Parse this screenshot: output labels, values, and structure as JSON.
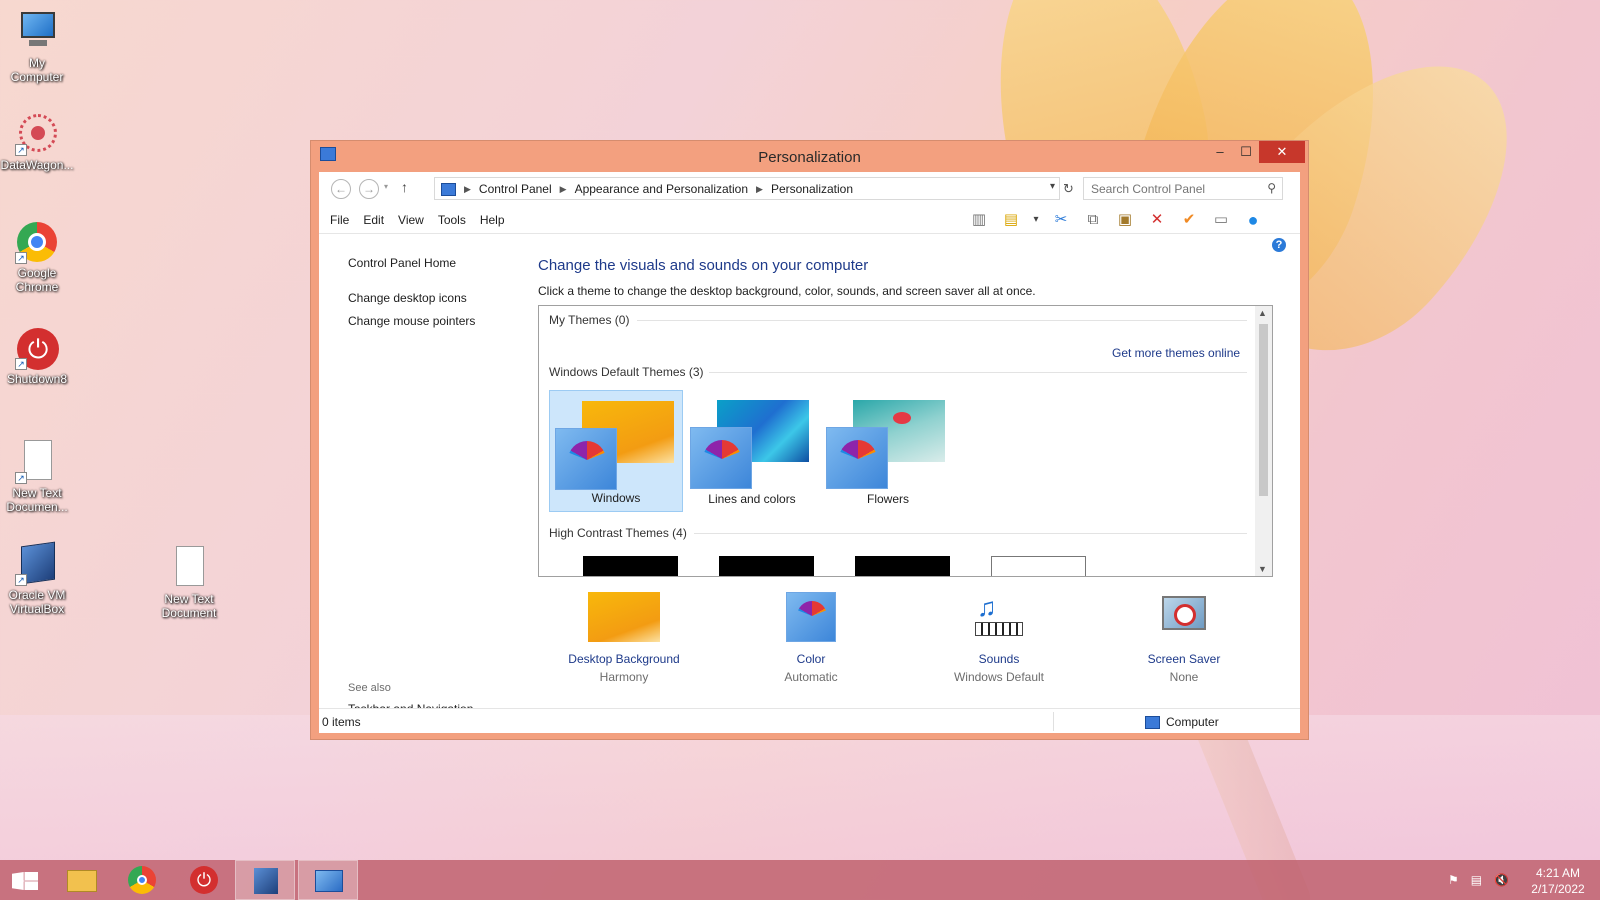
{
  "desktop": {
    "icons": [
      {
        "label": "My\nComputer"
      },
      {
        "label": "DataWagon..."
      },
      {
        "label": "Google\nChrome"
      },
      {
        "label": "Shutdown8"
      },
      {
        "label": "New Text\nDocumen..."
      },
      {
        "label": "Oracle VM\nVirtualBox"
      },
      {
        "label": "New Text\nDocument"
      }
    ]
  },
  "window": {
    "title": "Personalization",
    "controls": {
      "minimize": "–",
      "maximize": "☐",
      "close": "✕"
    },
    "address": {
      "crumbs": [
        "Control Panel",
        "Appearance and Personalization",
        "Personalization"
      ]
    },
    "search": {
      "placeholder": "Search Control Panel"
    },
    "menu": [
      "File",
      "Edit",
      "View",
      "Tools",
      "Help"
    ],
    "left_nav": {
      "home": "Control Panel Home",
      "links": [
        "Change desktop icons",
        "Change mouse pointers"
      ],
      "see_also_label": "See also",
      "see_also_links": [
        "Taskbar and Navigation"
      ]
    },
    "main": {
      "heading": "Change the visuals and sounds on your computer",
      "description": "Click a theme to change the desktop background, color, sounds, and screen saver all at once.",
      "sections": {
        "my_themes": "My Themes (0)",
        "get_more": "Get more themes online",
        "default_themes": "Windows Default Themes (3)",
        "high_contrast": "High Contrast Themes (4)"
      },
      "themes": [
        {
          "name": "Windows",
          "selected": true
        },
        {
          "name": "Lines and colors",
          "selected": false
        },
        {
          "name": "Flowers",
          "selected": false
        }
      ],
      "settings": [
        {
          "name": "Desktop Background",
          "value": "Harmony"
        },
        {
          "name": "Color",
          "value": "Automatic"
        },
        {
          "name": "Sounds",
          "value": "Windows Default"
        },
        {
          "name": "Screen Saver",
          "value": "None"
        }
      ]
    },
    "status": {
      "items": "0 items",
      "location": "Computer"
    }
  },
  "taskbar": {
    "clock": {
      "time": "4:21 AM",
      "date": "2/17/2022"
    }
  },
  "colors": {
    "window_frame": "#f3a07f",
    "close_button": "#c7372b",
    "link": "#1e3a8a",
    "selection": "#cde6fb",
    "taskbar": "#c46b78"
  }
}
